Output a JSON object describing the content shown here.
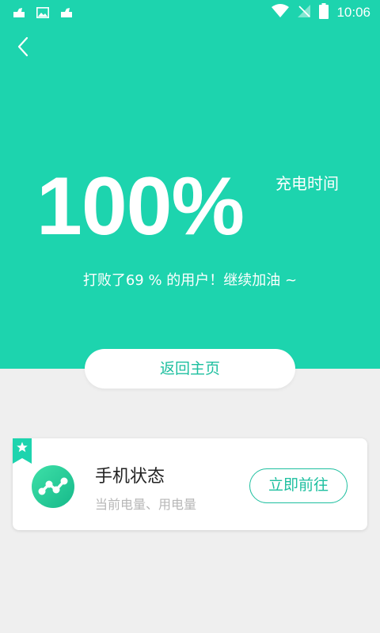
{
  "status_bar": {
    "time": "10:06",
    "left_icons": [
      "notification-app-icon",
      "image-icon",
      "notification-app-icon"
    ],
    "right_icons": [
      "wifi-icon",
      "no-signal-icon",
      "battery-icon"
    ]
  },
  "header": {
    "back_icon": "chevron-left-icon"
  },
  "charge": {
    "percent": "100%",
    "label": "充电时间",
    "beat_text": "打败了69 % 的用户！继续加油 ~"
  },
  "home_button": {
    "label": "返回主页"
  },
  "card": {
    "ribbon_icon": "star-icon",
    "app_icon": "phone-status-icon",
    "title": "手机状态",
    "subtitle": "当前电量、用电量",
    "action_label": "立即前往"
  },
  "colors": {
    "accent": "#1dd4ae",
    "accent_text": "#1dbf9f",
    "background": "#efefef",
    "card": "#ffffff"
  }
}
